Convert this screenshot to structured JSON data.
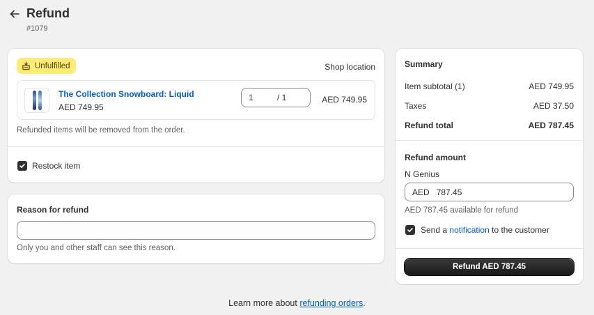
{
  "header": {
    "title": "Refund",
    "order_number": "#1079"
  },
  "items_card": {
    "status_badge": "Unfulfilled",
    "location": "Shop location",
    "line_item": {
      "title": "The Collection Snowboard: Liquid",
      "price": "AED 749.95",
      "quantity_value": "1",
      "quantity_total": "/ 1",
      "total": "AED 749.95"
    },
    "note": "Refunded items will be removed from the order.",
    "restock_label": "Restock item",
    "restock_checked": true
  },
  "reason_card": {
    "heading": "Reason for refund",
    "input_value": "",
    "note": "Only you and other staff can see this reason."
  },
  "summary": {
    "heading": "Summary",
    "rows": [
      {
        "label": "Item subtotal (1)",
        "value": "AED 749.95"
      },
      {
        "label": "Taxes",
        "value": "AED 37.50"
      },
      {
        "label": "Refund total",
        "value": "AED 787.45"
      }
    ],
    "refund_amount_heading": "Refund amount",
    "gateway": "N Genius",
    "currency": "AED",
    "amount": "787.45",
    "available": "AED 787.45 available for refund",
    "notify_prefix": "Send a",
    "notify_link": "notification",
    "notify_suffix": "to the customer",
    "notify_checked": true,
    "button_label": "Refund AED 787.45"
  },
  "footer": {
    "prefix": "Learn more about",
    "link": "refunding orders",
    "suffix": "."
  },
  "colors": {
    "background": "#f1f1f1",
    "link": "#005bd3",
    "badge": "#ffeb78",
    "primary_button": "#303030"
  }
}
